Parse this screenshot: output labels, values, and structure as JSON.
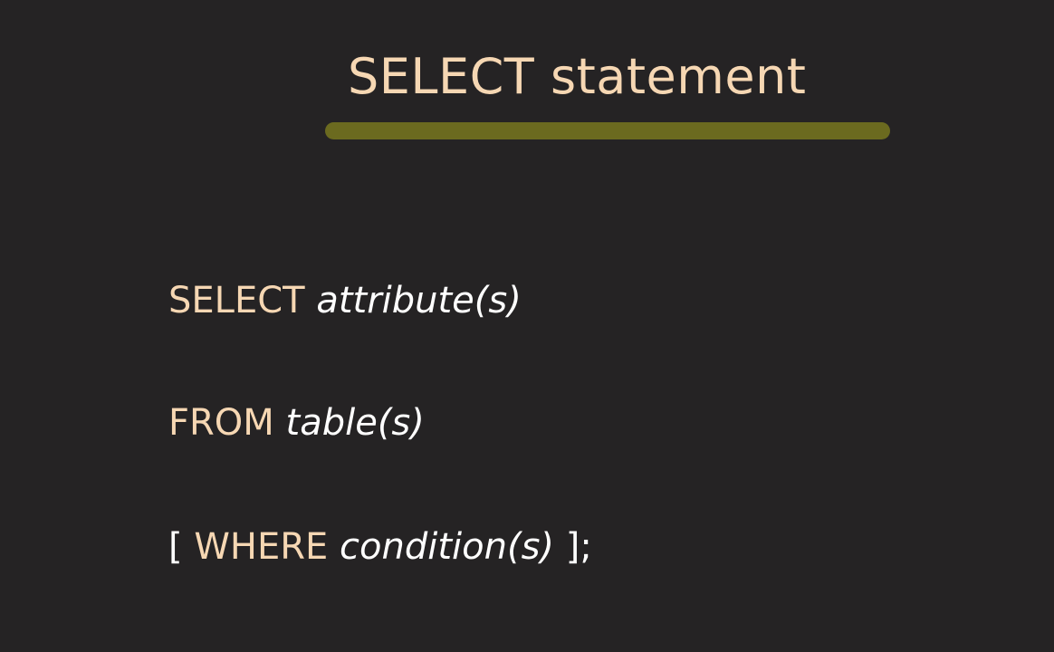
{
  "slide": {
    "title": "SELECT statement",
    "accent_color": "#6b6a1f",
    "keyword_color": "#f6d7b3",
    "text_color": "#ffffff",
    "background_color": "#252324"
  },
  "syntax": {
    "select": {
      "keyword": "SELECT",
      "argument": "attribute(s)"
    },
    "from": {
      "keyword": "FROM",
      "argument": "table(s)"
    },
    "where": {
      "open_bracket": "[",
      "keyword": "WHERE",
      "argument": "condition(s)",
      "close": "];"
    }
  }
}
